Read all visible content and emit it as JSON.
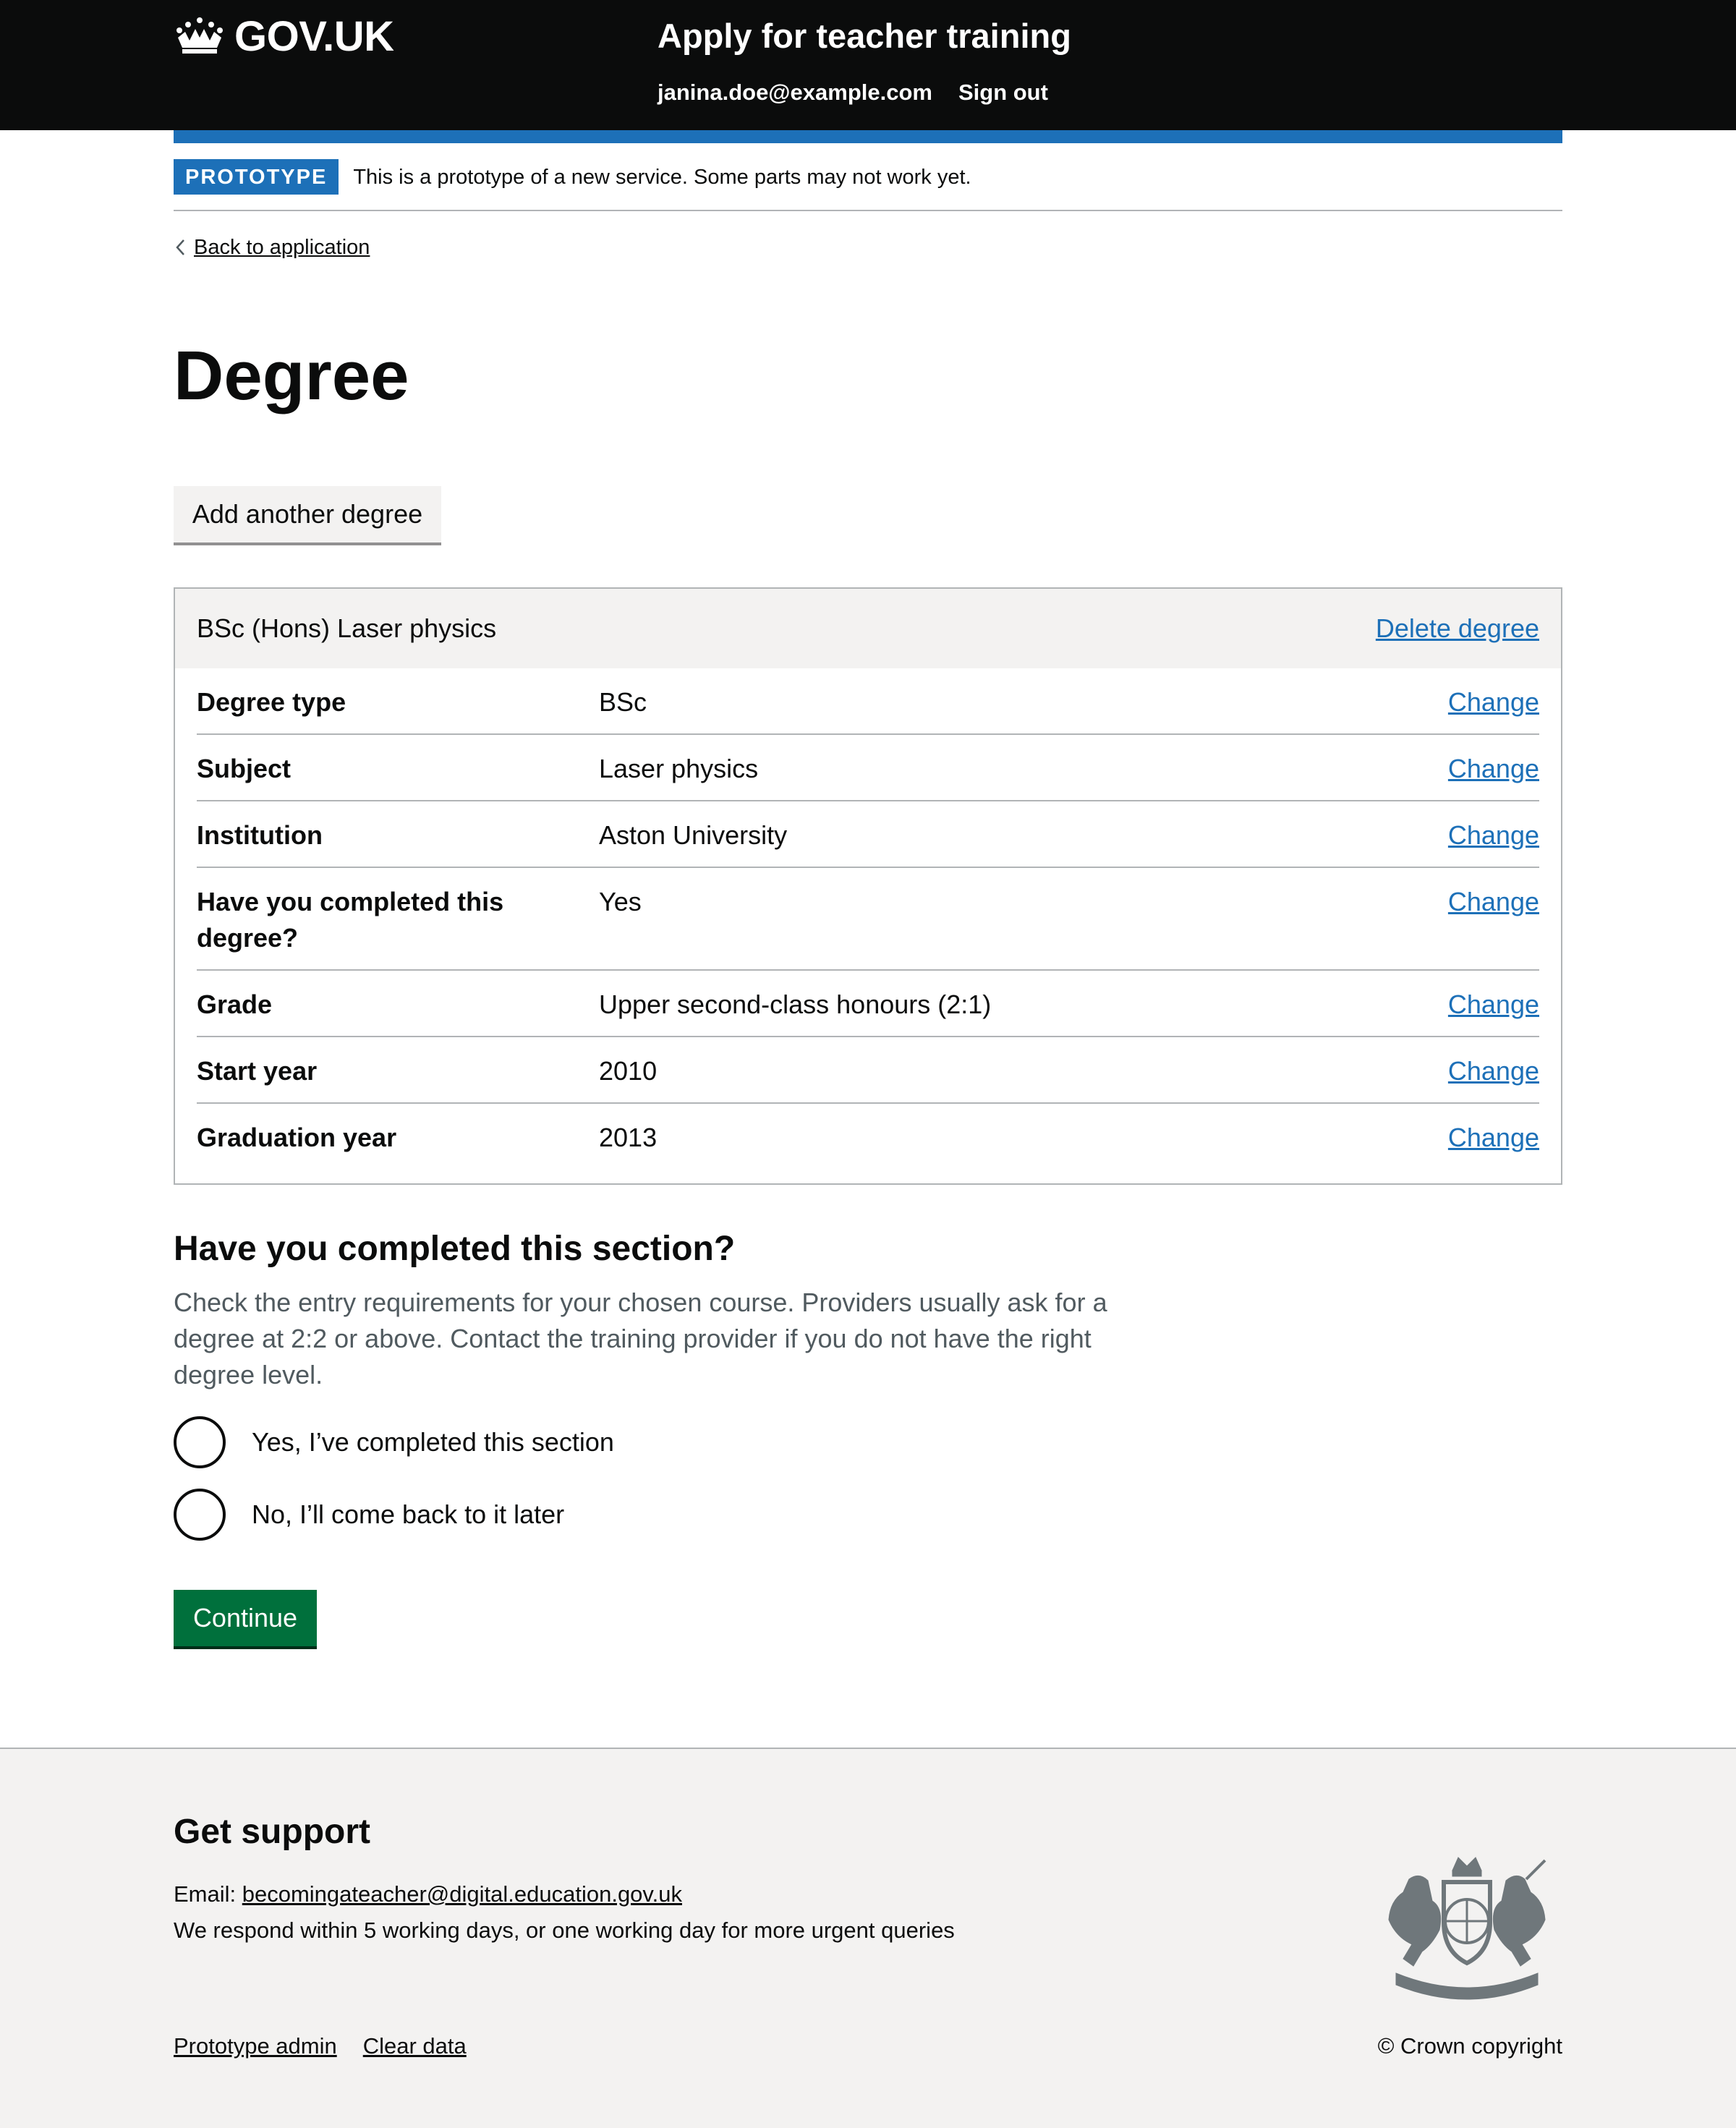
{
  "header": {
    "logo_text": "GOV.UK",
    "service_name": "Apply for teacher training",
    "nav": [
      "janina.doe@example.com",
      "Sign out"
    ]
  },
  "phase_banner": {
    "tag": "PROTOTYPE",
    "text": "This is a prototype of a new service. Some parts may not work yet."
  },
  "back_link": "Back to application",
  "page_title": "Degree",
  "add_button": "Add another degree",
  "card": {
    "title": "BSc (Hons) Laser physics",
    "delete_label": "Delete degree",
    "rows": [
      {
        "key": "Degree type",
        "value": "BSc",
        "action": "Change"
      },
      {
        "key": "Subject",
        "value": "Laser physics",
        "action": "Change"
      },
      {
        "key": "Institution",
        "value": "Aston University",
        "action": "Change"
      },
      {
        "key": "Have you completed this degree?",
        "value": "Yes",
        "action": "Change"
      },
      {
        "key": "Grade",
        "value": "Upper second-class honours (2:1)",
        "action": "Change"
      },
      {
        "key": "Start year",
        "value": "2010",
        "action": "Change"
      },
      {
        "key": "Graduation year",
        "value": "2013",
        "action": "Change"
      }
    ]
  },
  "section": {
    "heading": "Have you completed this section?",
    "hint": "Check the entry requirements for your chosen course. Providers usually ask for a degree at 2:2 or above. Contact the training provider if you do not have the right degree level.",
    "options": [
      "Yes, I’ve completed this section",
      "No, I’ll come back to it later"
    ],
    "continue_label": "Continue"
  },
  "footer": {
    "heading": "Get support",
    "email_label": "Email: ",
    "email": "becomingateacher@digital.education.gov.uk",
    "respond_text": "We respond within 5 working days, or one working day for more urgent queries",
    "links": [
      "Prototype admin",
      "Clear data"
    ],
    "copyright": "© Crown copyright"
  },
  "colors": {
    "header_bg": "#0b0c0c",
    "brand_blue": "#1d70b8",
    "link": "#1d70b8",
    "button_green": "#00703c",
    "footer_bg": "#f3f2f1",
    "hint_text": "#505a5f"
  }
}
